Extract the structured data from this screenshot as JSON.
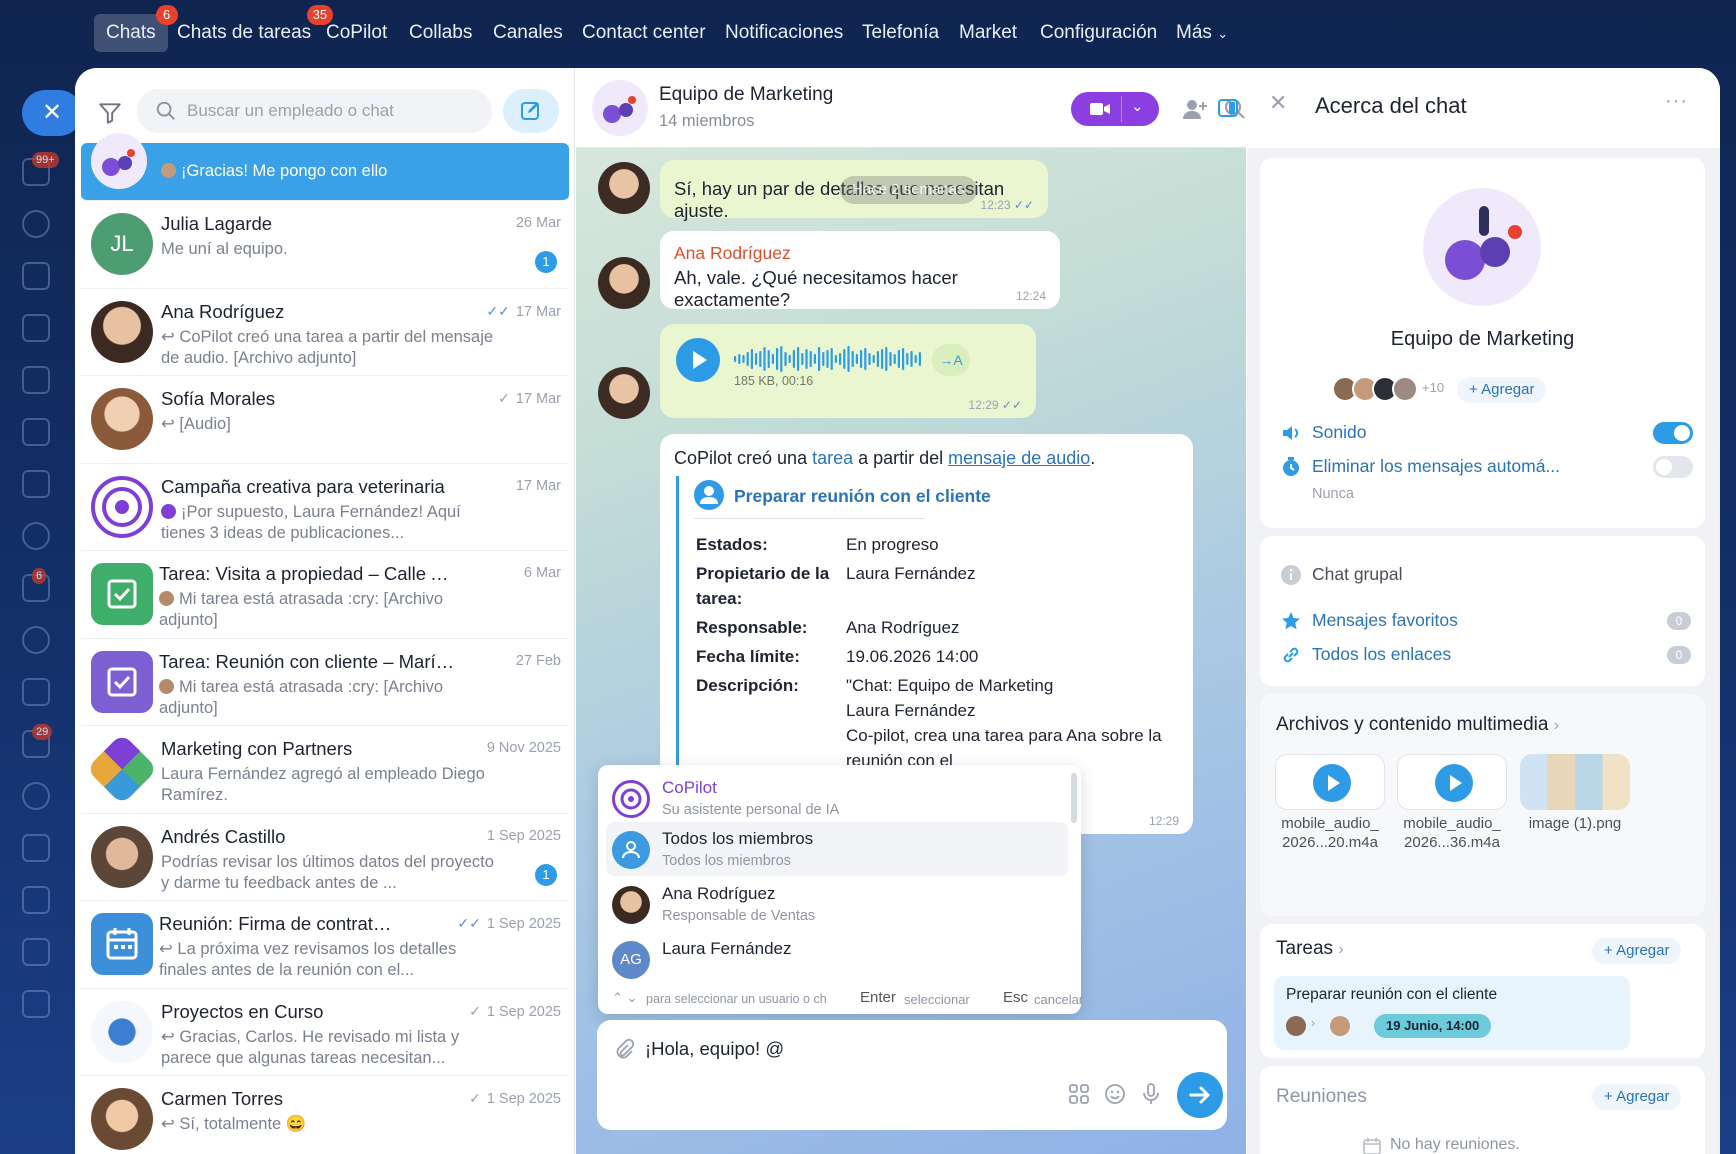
{
  "nav": {
    "items": [
      {
        "label": "Chats",
        "badge": "6"
      },
      {
        "label": "Chats de tareas",
        "badge": "35"
      },
      {
        "label": "CoPilot"
      },
      {
        "label": "Collabs"
      },
      {
        "label": "Canales"
      },
      {
        "label": "Contact center"
      },
      {
        "label": "Notificaciones"
      },
      {
        "label": "Telefonía"
      },
      {
        "label": "Market"
      },
      {
        "label": "Configuración"
      },
      {
        "label": "Más"
      }
    ]
  },
  "rail": {
    "badges": [
      "99+",
      "6",
      "29"
    ]
  },
  "chatlist": {
    "search_placeholder": "Buscar un empleado o chat",
    "items": [
      {
        "name": "Equipo de Marketing",
        "preview": "¡Gracias! Me pongo con ello",
        "date": "",
        "selected": true
      },
      {
        "name": "Julia Lagarde",
        "initials": "JL",
        "date": "26 Mar",
        "preview": "Me uní al equipo.",
        "count": "1"
      },
      {
        "name": "Ana Rodríguez",
        "date": "17 Mar",
        "preview": "↩ CoPilot creó una tarea a partir del mensaje de audio. [Archivo adjunto]"
      },
      {
        "name": "Sofía Morales",
        "date": "17 Mar",
        "preview": "↩ [Audio]"
      },
      {
        "name": "Campaña creativa para veterinaria",
        "date": "17 Mar",
        "preview": "¡Por supuesto, Laura Fernández! Aquí tienes 3 ideas de publicaciones..."
      },
      {
        "name": "Tarea: Visita a propiedad – Calle Alc...",
        "date": "6 Mar",
        "preview": "Mi tarea está atrasada :cry: [Archivo adjunto]"
      },
      {
        "name": "Tarea: Reunión con cliente – María ...",
        "date": "27 Feb",
        "preview": "Mi tarea está atrasada :cry: [Archivo adjunto]"
      },
      {
        "name": "Marketing con Partners",
        "date": "9 Nov 2025",
        "preview": "Laura Fernández agregó al empleado Diego Ramírez."
      },
      {
        "name": "Andrés Castillo",
        "date": "1 Sep 2025",
        "preview": "Podrías revisar los últimos datos del proyecto y darme tu feedback antes de ...",
        "count": "1"
      },
      {
        "name": "Reunión: Firma de contrato c...",
        "date": "1 Sep 2025",
        "preview": "↩ La próxima vez revisamos los detalles finales antes de la reunión con el..."
      },
      {
        "name": "Proyectos en Curso",
        "date": "1 Sep 2025",
        "preview": "↩ Gracias, Carlos. He revisado mi lista y parece que algunas tareas necesitan..."
      },
      {
        "name": "Carmen Torres",
        "date": "1 Sep 2025",
        "preview": "↩ Sí, totalmente 😄"
      }
    ]
  },
  "conversation": {
    "title": "Equipo de Marketing",
    "subtitle": "14 miembros",
    "messages": {
      "m1": {
        "text": "Sí, hay un par de detalles que necesitan ajuste.",
        "time": "12:23",
        "overlay": "Hace 2 semanas"
      },
      "m2": {
        "author": "Ana Rodríguez",
        "text": "Ah, vale. ¿Qué necesitamos hacer exactamente?",
        "time": "12:24"
      },
      "m3": {
        "meta": "185 KB, 00:16",
        "translate": "→A",
        "time": "12:29"
      },
      "m4": {
        "intro_1": "CoPilot creó una ",
        "link_task": "tarea",
        "intro_2": " a partir del ",
        "link_audio": "mensaje de audio",
        "intro_3": ".",
        "task_title": "Preparar reunión con el cliente",
        "fields": [
          {
            "k": "Estados:",
            "v": "En progreso"
          },
          {
            "k": "Propietario de la tarea:",
            "v": "Laura Fernández"
          },
          {
            "k": "Responsable:",
            "v": "Ana Rodríguez"
          },
          {
            "k": "Fecha límite:",
            "v": "19.06.2026 14:00"
          },
          {
            "k": "Descripción:",
            "v": "\"Chat: Equipo de Marketing\nLaura Fernández\nCo-pilot, crea una tarea para Ana sobre la reunión con el"
          }
        ],
        "time": "12:29"
      }
    },
    "mention": {
      "items": [
        {
          "name": "CoPilot",
          "sub": "Su asistente personal de IA"
        },
        {
          "name": "Todos los miembros",
          "sub": "Todos los miembros"
        },
        {
          "name": "Ana Rodríguez",
          "sub": "Responsable de Ventas"
        },
        {
          "name": "Laura Fernández",
          "initials": "AG",
          "sub": ""
        }
      ],
      "footer": {
        "hint_nav": "para seleccionar un usuario o chat",
        "enter": "Enter",
        "enter_hint": "seleccionar",
        "esc": "Esc",
        "esc_hint": "cancelar"
      }
    },
    "input": {
      "value": "¡Hola, equipo! @"
    }
  },
  "about": {
    "title": "Acerca del chat",
    "chat_name": "Equipo de Marketing",
    "members_more": "+10",
    "add_label": "Agregar",
    "sound_label": "Sonido",
    "sound_on": true,
    "autodelete_label": "Eliminar los mensajes automá...",
    "autodelete_on": false,
    "autodelete_value": "Nunca",
    "chat_type": "Chat grupal",
    "favorites_label": "Mensajes favoritos",
    "favorites_count": "0",
    "links_label": "Todos los enlaces",
    "links_count": "0",
    "files_title": "Archivos y contenido multimedia",
    "files": [
      {
        "name": "mobile_audio_\n2026...20.m4a"
      },
      {
        "name": "mobile_audio_\n2026...36.m4a"
      },
      {
        "name": "image (1).png"
      }
    ],
    "tasks_title": "Tareas",
    "task_item": {
      "title": "Preparar reunión con el cliente",
      "date": "19 Junio, 14:00"
    },
    "meetings_title": "Reuniones",
    "meetings_empty": "No hay reuniones."
  },
  "colors": {
    "accent": "#2e9be6",
    "call": "#8b3fe0",
    "badge": "#e8412e",
    "link": "#2a73b8"
  }
}
